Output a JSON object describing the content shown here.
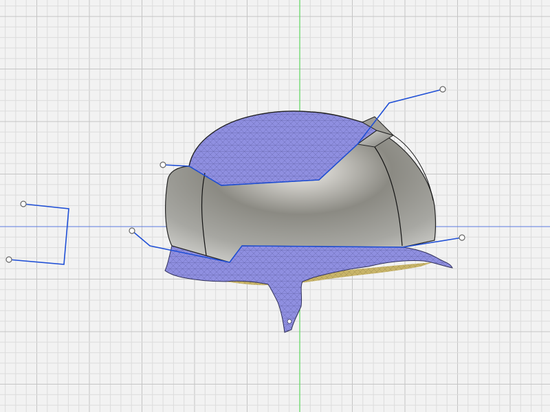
{
  "viewport": {
    "background": "#f2f2f2",
    "grid_minor_color": "#dcdcdc",
    "grid_major_color": "#c4c4c4",
    "axis_vertical_color": "#5cd65c",
    "axis_horizontal_color": "#5b7be0"
  },
  "model": {
    "mesh_color": "#8f8fe0",
    "mesh_wire_color": "#4a4a8a",
    "inner_surface_color": "#c8b469",
    "brep_surface_color": "#8a8a84",
    "brep_edge_color": "#222222",
    "highlight_color": "#ffffff"
  },
  "sketch": {
    "line_color": "#1f4fd6",
    "handle_fill": "#ffffff",
    "handle_stroke": "#666666"
  }
}
